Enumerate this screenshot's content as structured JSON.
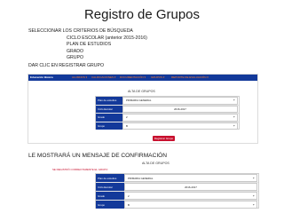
{
  "page": {
    "title": "Registro de Grupos"
  },
  "instructions": {
    "heading": "SELECCIONAR LOS CRITERIOS DE BÚSQUEDA",
    "criteria": [
      "CICLO ESCOLAR (anterior 2015-2016)",
      "PLAN DE ESTUDIOS",
      "GRADO",
      "GRUPO"
    ],
    "action": "DAR CLIC EN REGISTRAR GRUPO"
  },
  "screenshot": {
    "brand": "Educación Básica",
    "nav": [
      "ALUMNOS ▾",
      "CALIFICACIONES ▾",
      "DOCUMENTACIÓN ▾",
      "GRUPOS ▾",
      "REPORTE DE EVALUACIÓN ▾"
    ],
    "section_title": "ALTA DE GRUPOS",
    "form": [
      {
        "label": "Plan de estudios",
        "value": "PRIMARIA GENERAL",
        "select": true
      },
      {
        "label": "Ciclo Escolar",
        "value": "2016-2017",
        "select": false
      },
      {
        "label": "Grado",
        "value": "2",
        "select": true
      },
      {
        "label": "Grupo",
        "value": "B",
        "select": true
      }
    ],
    "button": "Registrar Grupo"
  },
  "confirmation": {
    "message": "LE MOSTRARÁ UN MENSAJE DE CONFIRMACIÓN",
    "section_title": "ALTA DE GRUPOS",
    "success": "SE REGISTRÓ CORRECTAMENTE EL GRUPO",
    "form": [
      {
        "label": "Plan de estudios",
        "value": "PRIMARIA GENERAL",
        "select": true
      },
      {
        "label": "Ciclo Escolar",
        "value": "2016-2017",
        "select": false
      },
      {
        "label": "Grado",
        "value": "2",
        "select": true
      },
      {
        "label": "Grupo",
        "value": "B",
        "select": true
      }
    ]
  }
}
